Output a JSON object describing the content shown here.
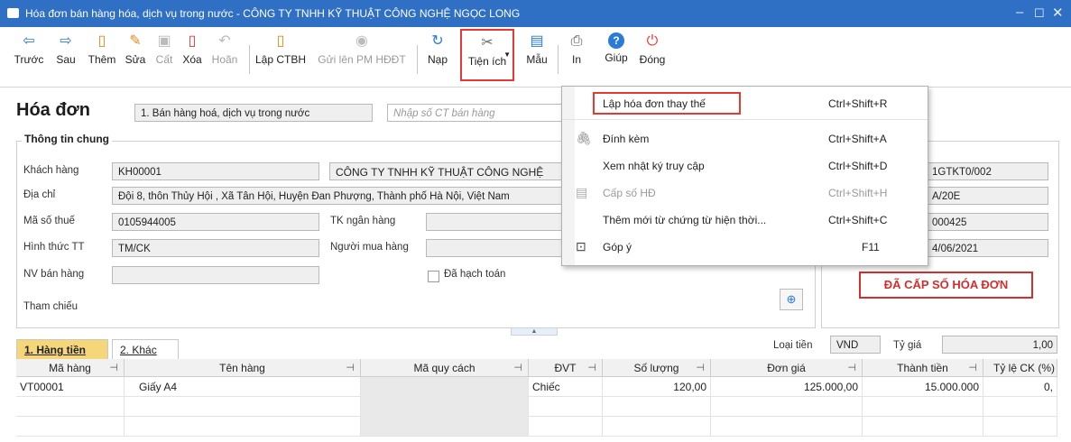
{
  "window": {
    "title": "Hóa đơn bán hàng hóa, dịch vụ trong nước - CÔNG TY TNHH KỸ THUẬT CÔNG NGHỆ NGỌC LONG",
    "controls": [
      "–",
      "☐",
      "✕"
    ]
  },
  "toolbar": {
    "items": [
      {
        "label": "Trước",
        "icon": "arrow-left-icon",
        "glyph": "⇦"
      },
      {
        "label": "Sau",
        "icon": "arrow-right-icon",
        "glyph": "⇨"
      },
      {
        "label": "Thêm",
        "icon": "add-doc-icon",
        "glyph": "▯"
      },
      {
        "label": "Sửa",
        "icon": "edit-icon",
        "glyph": "✎"
      },
      {
        "label": "Cất",
        "icon": "save-icon",
        "glyph": "▣"
      },
      {
        "label": "Xóa",
        "icon": "delete-icon",
        "glyph": "▯"
      },
      {
        "label": "Hoãn",
        "icon": "undo-icon",
        "glyph": "↶"
      },
      {
        "label": "Lập CTBH",
        "icon": "document-icon",
        "glyph": "▯"
      },
      {
        "label": "Gửi lên PM HĐĐT",
        "icon": "upload-icon",
        "glyph": "◉"
      },
      {
        "label": "Nạp",
        "icon": "refresh-icon",
        "glyph": "↻"
      },
      {
        "label": "Tiện ích",
        "icon": "tools-icon",
        "glyph": "✂"
      },
      {
        "label": "Mẫu",
        "icon": "template-icon",
        "glyph": "▤"
      },
      {
        "label": "In",
        "icon": "print-icon",
        "glyph": "⎙"
      },
      {
        "label": "Giúp",
        "icon": "help-icon",
        "glyph": "?"
      },
      {
        "label": "Đóng",
        "icon": "close-icon",
        "glyph": "⏻"
      }
    ]
  },
  "header": {
    "title": "Hóa đơn",
    "invoice_type": "1. Bán hàng hoá, dịch vụ trong nước",
    "search_placeholder": "Nhập số CT bán hàng"
  },
  "general": {
    "group_title": "Thông tin chung",
    "customer_label": "Khách hàng",
    "customer_code": "KH00001",
    "customer_name": "CÔNG TY TNHH KỸ THUẬT CÔNG NGHỆ",
    "address_label": "Địa chỉ",
    "address": "Đội 8, thôn Thủy Hội , Xã Tân Hội, Huyện Đan Phượng, Thành phố Hà Nội, Việt Nam",
    "tax_label": "Mã số thuế",
    "tax_code": "0105944005",
    "bank_label": "TK ngân hàng",
    "bank_value": "",
    "payment_label": "Hình thức TT",
    "payment_value": "TM/CK",
    "buyer_label": "Người mua hàng",
    "buyer_value": "",
    "seller_label": "NV bán hàng",
    "seller_value": "",
    "posted_label": "Đã hạch toán",
    "ref_label": "Tham chiếu"
  },
  "invoice_info": {
    "template": "1GTKT0/002",
    "series": "A/20E",
    "number": "000425",
    "date": "4/06/2021",
    "status": "ĐÃ CẤP SỐ HÓA ĐƠN"
  },
  "menu": {
    "items": [
      {
        "label": "Lập hóa đơn thay thế",
        "shortcut": "Ctrl+Shift+R",
        "icon": "",
        "enabled": true
      },
      {
        "label": "Đính kèm",
        "shortcut": "Ctrl+Shift+A",
        "icon": "paperclip-icon",
        "enabled": true
      },
      {
        "label": "Xem nhật ký truy cập",
        "shortcut": "Ctrl+Shift+D",
        "icon": "",
        "enabled": true
      },
      {
        "label": "Cấp số HĐ",
        "shortcut": "Ctrl+Shift+H",
        "icon": "number-icon",
        "enabled": false
      },
      {
        "label": "Thêm mới từ chứng từ hiện thời...",
        "shortcut": "Ctrl+Shift+C",
        "icon": "",
        "enabled": true
      },
      {
        "label": "Góp ý",
        "shortcut": "F11",
        "icon": "feedback-icon",
        "enabled": true
      }
    ]
  },
  "detail": {
    "tabs": [
      "1. Hàng tiền",
      "2. Khác"
    ],
    "currency_label": "Loại tiền",
    "currency": "VND",
    "rate_label": "Tỷ giá",
    "rate": "1,00",
    "columns": [
      "Mã hàng",
      "Tên hàng",
      "Mã quy cách",
      "ĐVT",
      "Số lượng",
      "Đơn giá",
      "Thành tiền",
      "Tỷ lệ CK (%)"
    ],
    "rows": [
      {
        "ma_hang": "VT00001",
        "ten_hang": "Giấy A4",
        "ma_quy_cach": "",
        "dvt": "Chiếc",
        "so_luong": "120,00",
        "don_gia": "125.000,00",
        "thanh_tien": "15.000.000",
        "ty_le_ck": "0,"
      }
    ]
  },
  "colors": {
    "titlebar": "#2f6fc4",
    "highlight": "#e53935",
    "status_text": "#d32f2f",
    "tab_active": "#f5d77a"
  }
}
